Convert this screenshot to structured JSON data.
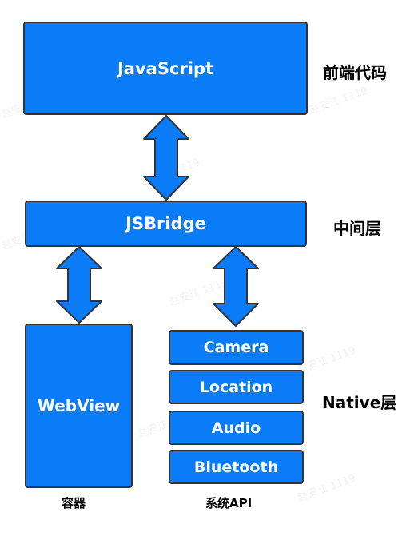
{
  "colors": {
    "box_fill": "#0a7cf8",
    "border": "#333333"
  },
  "boxes": {
    "javascript": "JavaScript",
    "jsbridge": "JSBridge",
    "webview": "WebView",
    "camera": "Camera",
    "location": "Location",
    "audio": "Audio",
    "bluetooth": "Bluetooth"
  },
  "labels": {
    "frontend": "前端代码",
    "middle": "中间层",
    "native": "Native层",
    "container": "容器",
    "system_api": "系统API"
  },
  "watermark": "赵安江 1119"
}
